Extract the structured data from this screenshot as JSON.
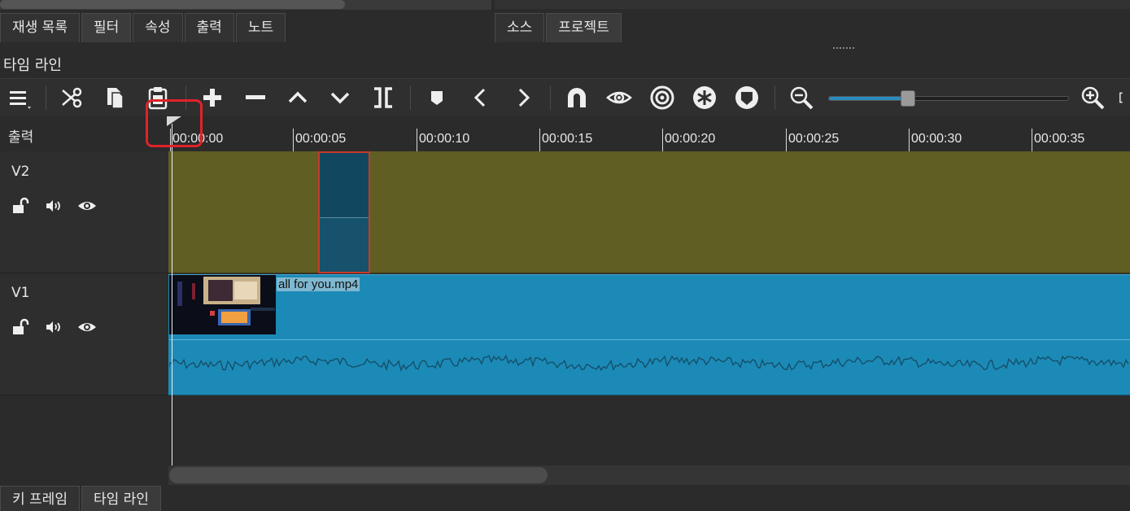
{
  "tabs_top_left": [
    "재생 목록",
    "필터",
    "속성",
    "출력",
    "노트"
  ],
  "tabs_top_right": [
    "소스",
    "프로젝트"
  ],
  "panel_title": "타임 라인",
  "ruler": {
    "label": "출력",
    "ticks": [
      "00:00:00",
      "00:00:05",
      "00:00:10",
      "00:00:15",
      "00:00:20",
      "00:00:25",
      "00:00:30",
      "00:00:35"
    ]
  },
  "tracks": [
    {
      "name": "V2"
    },
    {
      "name": "V1",
      "clip_name": "all for you.mp4"
    }
  ],
  "zoom": {
    "level": 0.33
  },
  "tabs_bottom": [
    "키 프레임",
    "타임 라인"
  ],
  "colors": {
    "v2_track": "#615e24",
    "v1_clip": "#1c8ab7",
    "highlight": "#e0222a",
    "zoom_fill": "#2a8bc0"
  },
  "toolbar_icons": [
    "menu-icon",
    "scissors-icon",
    "copy-icon",
    "paste-icon",
    "plus-icon",
    "minus-icon",
    "chevron-up-icon",
    "chevron-down-icon",
    "split-icon",
    "marker-icon",
    "previous-marker-icon",
    "next-marker-icon",
    "snap-magnet-icon",
    "scrub-eye-icon",
    "ripple-target-icon",
    "ripple-all-icon",
    "ripple-markers-icon",
    "zoom-out-icon",
    "zoom-in-icon"
  ]
}
